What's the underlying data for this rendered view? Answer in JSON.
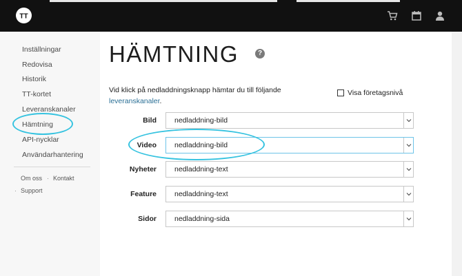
{
  "header": {
    "logo_text": "TT",
    "icons": [
      "cart-icon",
      "calendar-icon",
      "user-icon"
    ]
  },
  "sidebar": {
    "items": [
      {
        "label": "Inställningar"
      },
      {
        "label": "Redovisa"
      },
      {
        "label": "Historik"
      },
      {
        "label": "TT-kortet"
      },
      {
        "label": "Leveranskanaler"
      },
      {
        "label": "Hämtning",
        "highlighted": true
      },
      {
        "label": "API-nycklar"
      },
      {
        "label": "Användarhantering"
      }
    ],
    "footer": {
      "about": "Om oss",
      "separator": "·",
      "contact": "Kontakt",
      "bullet": "·",
      "support": "Support"
    }
  },
  "main": {
    "title": "HÄMTNING",
    "help": "?",
    "intro_text": "Vid klick på nedladdningsknapp hämtar du till följande",
    "intro_link": "leveranskanaler",
    "intro_end": ".",
    "checkbox_label": "Visa företagsnivå",
    "checkbox_checked": false,
    "rows": [
      {
        "label": "Bild",
        "value": "nedladdning-bild"
      },
      {
        "label": "Video",
        "value": "nedladdning-bild",
        "highlighted": true
      },
      {
        "label": "Nyheter",
        "value": "nedladdning-text"
      },
      {
        "label": "Feature",
        "value": "nedladdning-text"
      },
      {
        "label": "Sidor",
        "value": "nedladdning-sida"
      }
    ]
  },
  "colors": {
    "topbar": "#111111",
    "highlight_ring": "#36c3e0",
    "link": "#2a6f95"
  }
}
